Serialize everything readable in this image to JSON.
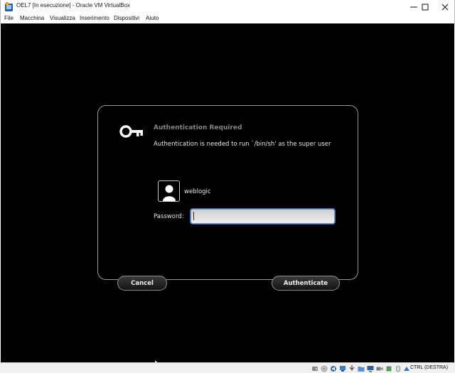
{
  "window": {
    "title": "OEL7 [In esecuzione] - Oracle VM VirtualBox"
  },
  "menubar": {
    "items": [
      "File",
      "Macchina",
      "Visualizza",
      "Inserimento",
      "Dispositivi",
      "Aiuto"
    ]
  },
  "dialog": {
    "title": "Authentication Required",
    "message": "Authentication is needed to run `/bin/sh' as the super user",
    "user_name": "weblogic",
    "password_label": "Password:",
    "password_value": "",
    "cancel_label": "Cancel",
    "authenticate_label": "Authenticate"
  },
  "statusbar": {
    "host_key": "CTRL (DESTRA)",
    "icons": [
      "hard-disk-icon",
      "optical-drive-icon",
      "audio-icon",
      "network-icon",
      "usb-icon",
      "shared-folders-icon",
      "display-icon",
      "video-capture-icon",
      "cpu-icon",
      "mouse-integration-icon",
      "host-key-icon"
    ]
  },
  "colors": {
    "vm_background": "#000000",
    "dialog_border": "#9a9a9a",
    "focus_border": "#6a93c9"
  }
}
